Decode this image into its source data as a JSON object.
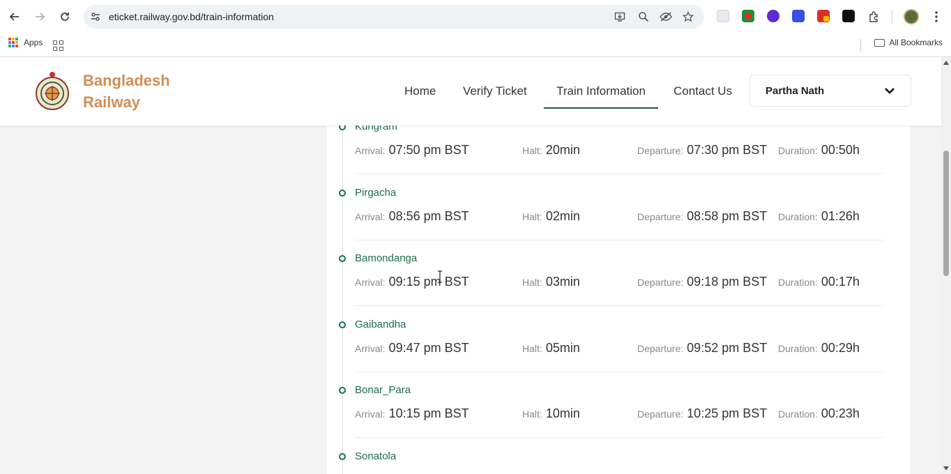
{
  "browser": {
    "url": "eticket.railway.gov.bd/train-information",
    "bookmarks": {
      "apps_label": "Apps",
      "all_bookmarks_label": "All Bookmarks"
    }
  },
  "site": {
    "brand_line1": "Bangladesh",
    "brand_line2": "Railway",
    "nav": {
      "home": "Home",
      "verify_ticket": "Verify Ticket",
      "train_information": "Train Information",
      "contact_us": "Contact Us"
    },
    "user_name": "Partha Nath"
  },
  "labels": {
    "arrival": "Arrival:",
    "halt": "Halt:",
    "departure": "Departure:",
    "duration": "Duration:"
  },
  "stops": [
    {
      "name": "Kurigram",
      "arrival": "07:50 pm BST",
      "halt": "20min",
      "departure": "07:30 pm BST",
      "duration": "00:50h"
    },
    {
      "name": "Pirgacha",
      "arrival": "08:56 pm BST",
      "halt": "02min",
      "departure": "08:58 pm BST",
      "duration": "01:26h"
    },
    {
      "name": "Bamondanga",
      "arrival": "09:15 pm BST",
      "halt": "03min",
      "departure": "09:18 pm BST",
      "duration": "00:17h"
    },
    {
      "name": "Gaibandha",
      "arrival": "09:47 pm BST",
      "halt": "05min",
      "departure": "09:52 pm BST",
      "duration": "00:29h"
    },
    {
      "name": "Bonar_Para",
      "arrival": "10:15 pm BST",
      "halt": "10min",
      "departure": "10:25 pm BST",
      "duration": "00:23h"
    },
    {
      "name": "Sonatola"
    }
  ],
  "colors": {
    "brand": "#d28d50",
    "accent": "#1b6e4a"
  }
}
